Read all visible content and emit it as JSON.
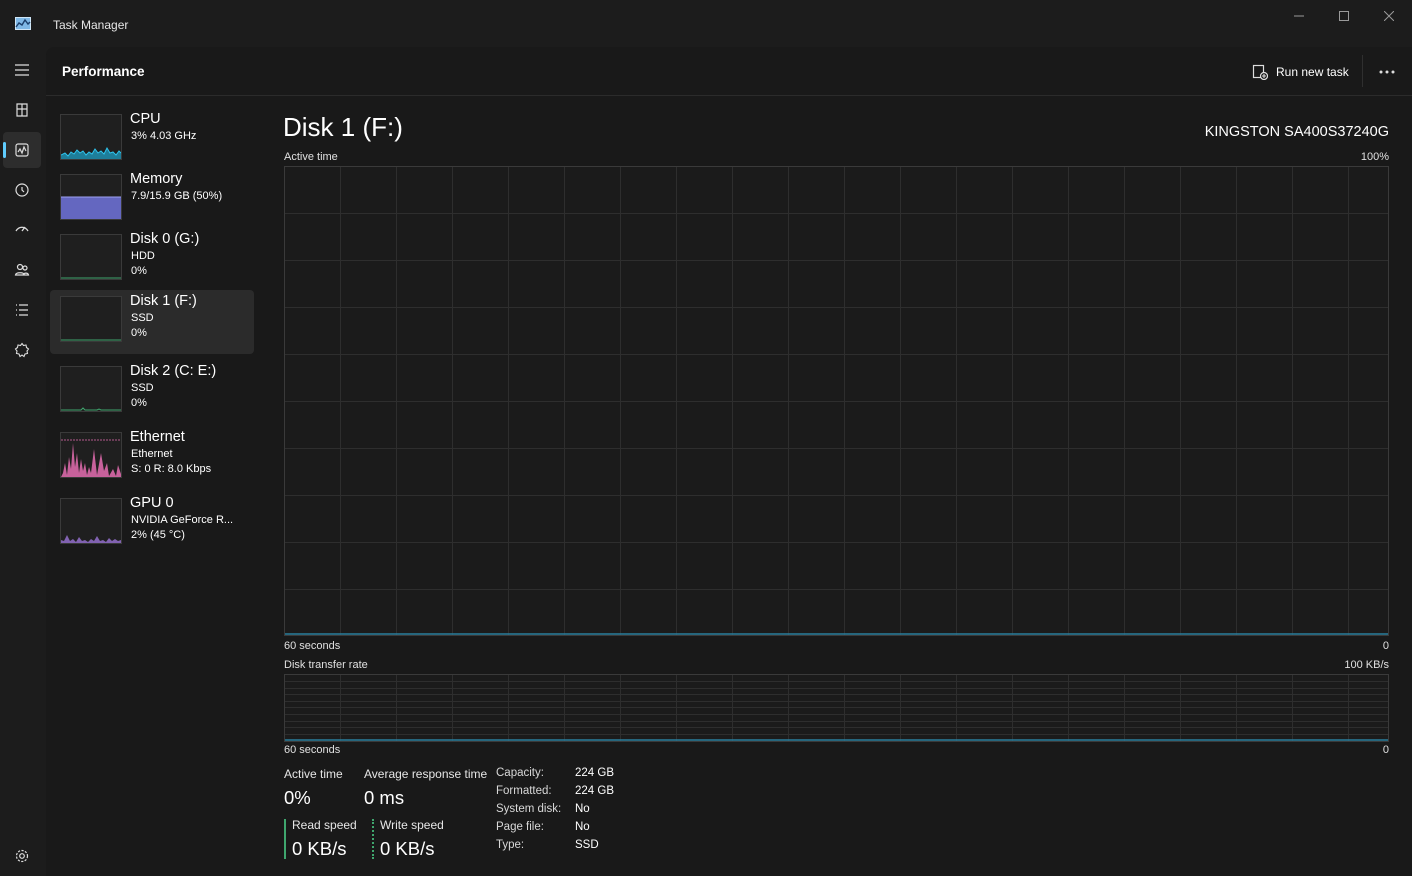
{
  "window": {
    "title": "Task Manager"
  },
  "header": {
    "title": "Performance",
    "run_new_task": "Run new task"
  },
  "rail": [
    "hamburger-menu-icon",
    "processes-icon",
    "performance-icon",
    "app-history-icon",
    "startup-apps-icon",
    "users-icon",
    "details-icon",
    "services-icon",
    "settings-icon"
  ],
  "devices": [
    {
      "name": "CPU",
      "line2": "3%  4.03 GHz",
      "line3": "",
      "color": "#1f9fc4"
    },
    {
      "name": "Memory",
      "line2": "7.9/15.9 GB (50%)",
      "line3": "",
      "color": "#6b6fd1"
    },
    {
      "name": "Disk 0 (G:)",
      "line2": "HDD",
      "line3": "0%",
      "color": "#3fa66e"
    },
    {
      "name": "Disk 1 (F:)",
      "line2": "SSD",
      "line3": "0%",
      "color": "#3fa66e"
    },
    {
      "name": "Disk 2 (C: E:)",
      "line2": "SSD",
      "line3": "0%",
      "color": "#3fa66e"
    },
    {
      "name": "Ethernet",
      "line2": "Ethernet",
      "line3": "S: 0  R: 8.0 Kbps",
      "color": "#e56db1"
    },
    {
      "name": "GPU 0",
      "line2": "NVIDIA GeForce R...",
      "line3": "2%  (45 °C)",
      "color": "#9a73d6"
    }
  ],
  "main": {
    "title": "Disk 1 (F:)",
    "model": "KINGSTON SA400S37240G",
    "active_time_label": "Active time",
    "active_time_max": "100%",
    "graph1_left": "60 seconds",
    "graph1_right": "0",
    "transfer_label": "Disk transfer rate",
    "transfer_max": "100 KB/s",
    "graph2_left": "60 seconds",
    "graph2_right": "0"
  },
  "stats": {
    "active_time_label": "Active time",
    "active_time_value": "0%",
    "avg_response_label": "Average response time",
    "avg_response_value": "0 ms",
    "read_label": "Read speed",
    "read_value": "0 KB/s",
    "write_label": "Write speed",
    "write_value": "0 KB/s"
  },
  "info": [
    {
      "key": "Capacity:",
      "value": "224 GB"
    },
    {
      "key": "Formatted:",
      "value": "224 GB"
    },
    {
      "key": "System disk:",
      "value": "No"
    },
    {
      "key": "Page file:",
      "value": "No"
    },
    {
      "key": "Type:",
      "value": "SSD"
    }
  ],
  "colors": {
    "accent": "#60cdff",
    "disk": "#3fa66e",
    "graph_line": "#2a7f9e"
  }
}
